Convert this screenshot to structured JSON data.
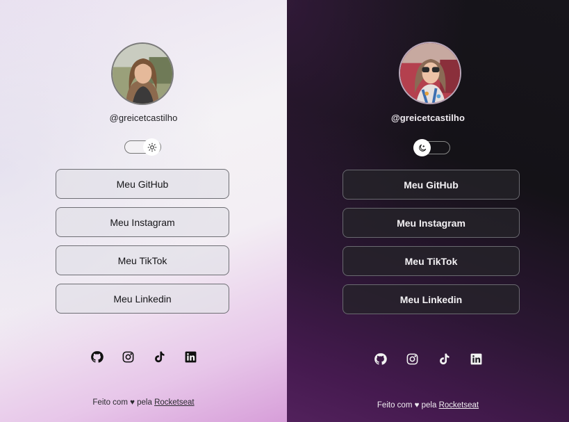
{
  "light": {
    "avatar_alt": "Foto de perfil",
    "handle": "@greicetcastilho",
    "links": [
      "Meu GitHub",
      "Meu Instagram",
      "Meu TikTok",
      "Meu Linkedin"
    ],
    "socials": [
      "github-icon",
      "instagram-icon",
      "tiktok-icon",
      "linkedin-icon"
    ],
    "footer": {
      "prefix": "Feito com ♥ pela ",
      "link": "Rocketseat"
    },
    "theme_icon": "sun-icon",
    "colors": {
      "bg_start": "#eae2f1",
      "bg_end": "#d79ed9",
      "text": "#1e1e22"
    }
  },
  "dark": {
    "avatar_alt": "Foto de perfil",
    "handle": "@greicetcastilho",
    "links": [
      "Meu GitHub",
      "Meu Instagram",
      "Meu TikTok",
      "Meu Linkedin"
    ],
    "socials": [
      "github-icon",
      "instagram-icon",
      "tiktok-icon",
      "linkedin-icon"
    ],
    "footer": {
      "prefix": "Feito com ♥ pela ",
      "link": "Rocketseat"
    },
    "theme_icon": "moon-icon",
    "colors": {
      "bg_start": "#17151b",
      "bg_end": "#52215c",
      "text": "#f2eef3"
    }
  }
}
